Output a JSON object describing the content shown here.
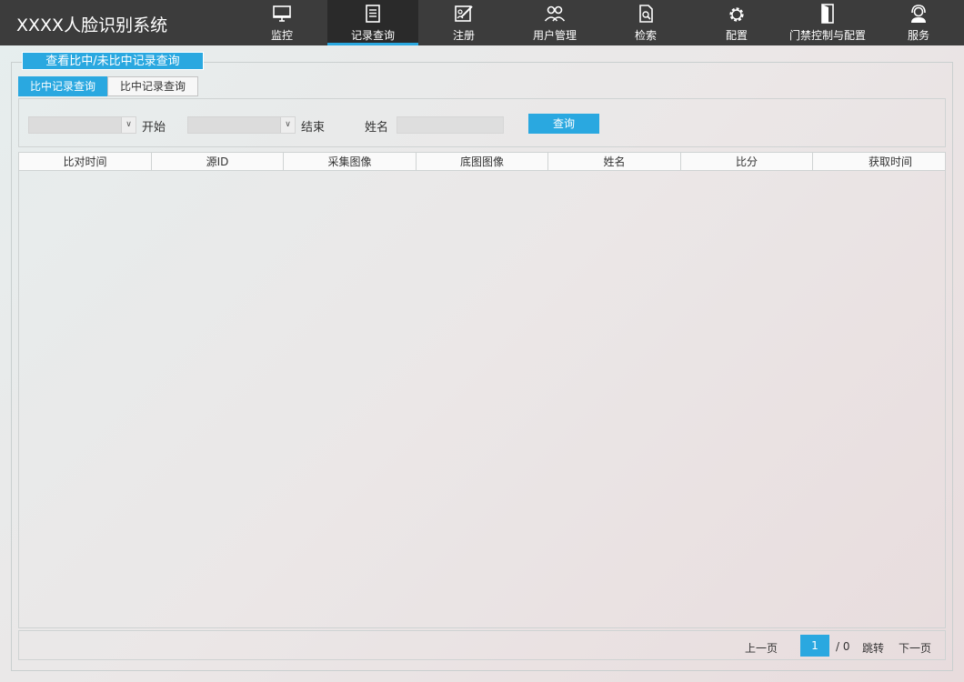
{
  "app": {
    "title": "XXXX人脸识别系统"
  },
  "nav": [
    {
      "label": "监控",
      "icon": "monitor-icon"
    },
    {
      "label": "记录查询",
      "icon": "document-icon",
      "active": true
    },
    {
      "label": "注册",
      "icon": "register-edit-icon"
    },
    {
      "label": "用户管理",
      "icon": "users-icon"
    },
    {
      "label": "检索",
      "icon": "search-document-icon"
    },
    {
      "label": "配置",
      "icon": "gear-icon"
    },
    {
      "label": "门禁控制与配置",
      "icon": "door-icon"
    },
    {
      "label": "服务",
      "icon": "headset-icon"
    }
  ],
  "panel": {
    "title": "查看比中/未比中记录查询"
  },
  "tabs": [
    {
      "label": "比中记录查询",
      "active": true
    },
    {
      "label": "比中记录查询",
      "active": false
    }
  ],
  "filter": {
    "start_label": "开始",
    "end_label": "结束",
    "name_label": "姓名",
    "start_value": "",
    "end_value": "",
    "name_value": "",
    "query_button": "查询"
  },
  "table": {
    "columns": [
      "比对时间",
      "源ID",
      "采集图像",
      "底图图像",
      "姓名",
      "比分",
      "获取时间"
    ],
    "rows": []
  },
  "pager": {
    "prev": "上一页",
    "current": "1",
    "total": "/ 0",
    "jump": "跳转",
    "next": "下一页"
  },
  "colors": {
    "accent": "#2aa8e0",
    "topbar": "#3c3c3c"
  }
}
